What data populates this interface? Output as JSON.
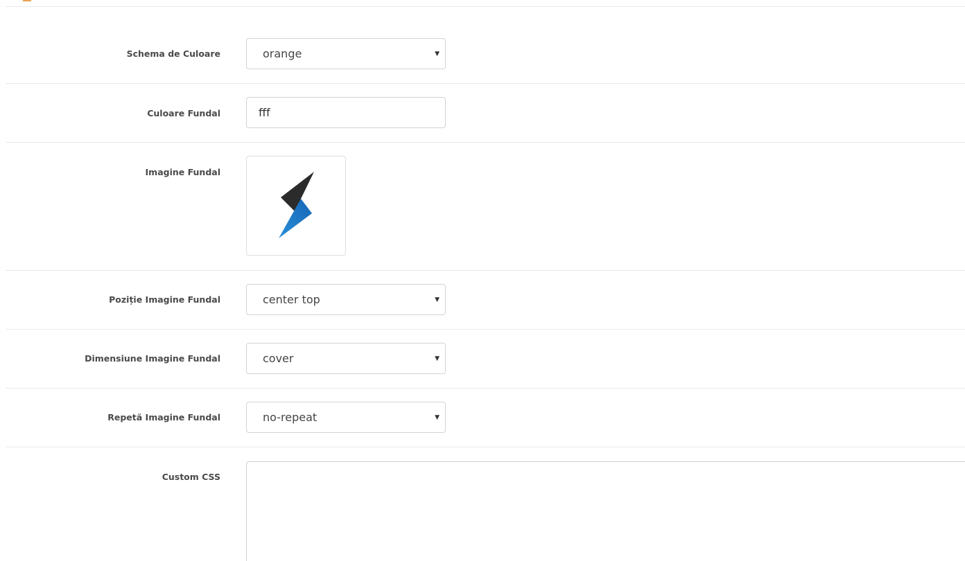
{
  "form": {
    "color_scheme": {
      "label": "Schema de Culoare",
      "value": "orange"
    },
    "background_color": {
      "label": "Culoare Fundal",
      "value": "fff"
    },
    "background_image": {
      "label": "Imagine Fundal",
      "icon": "lightning-bolt-logo-icon"
    },
    "background_position": {
      "label": "Poziție Imagine Fundal",
      "value": "center top"
    },
    "background_size": {
      "label": "Dimensiune Imagine Fundal",
      "value": "cover"
    },
    "background_repeat": {
      "label": "Repetă Imagine Fundal",
      "value": "no-repeat"
    },
    "custom_css": {
      "label": "Custom CSS",
      "value": ""
    }
  },
  "colors": {
    "accent": "#e8a24c",
    "logo_dark": "#2b2b2b",
    "logo_blue": "#1a7ccc"
  }
}
